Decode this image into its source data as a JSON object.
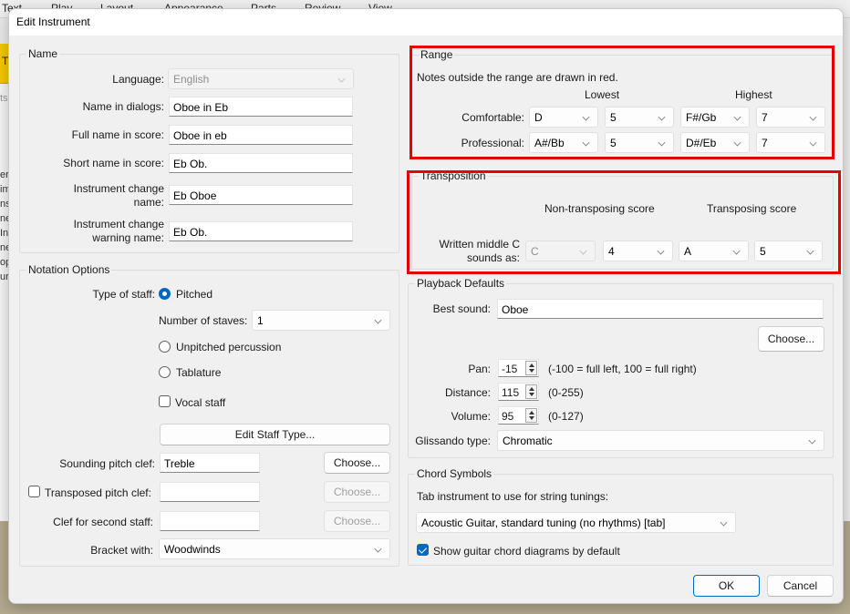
{
  "background_app": {
    "menu": [
      "Text",
      "Play",
      "Layout",
      "Appearance",
      "Parts",
      "Review",
      "View"
    ],
    "toolbar_fragment": "Tr",
    "panel_fragments": [
      "ts",
      "er",
      "im",
      "ns",
      "ne",
      "In",
      "ne",
      "op",
      "ur"
    ]
  },
  "dialog": {
    "title": "Edit Instrument",
    "name_group": {
      "legend": "Name",
      "language_label": "Language:",
      "language_value": "English",
      "name_in_dialogs_label": "Name in dialogs:",
      "name_in_dialogs_value": "Oboe in Eb",
      "full_name_label": "Full name in score:",
      "full_name_value": "Oboe in eb",
      "short_name_label": "Short name in score:",
      "short_name_value": "Eb Ob.",
      "change_name_label": "Instrument change name:",
      "change_name_value": "Eb Oboe",
      "change_warning_label": "Instrument change warning name:",
      "change_warning_value": "Eb Ob."
    },
    "notation_group": {
      "legend": "Notation Options",
      "type_of_staff_label": "Type of staff:",
      "pitched_label": "Pitched",
      "pitched_selected": true,
      "num_staves_label": "Number of staves:",
      "num_staves_value": "1",
      "unpitched_label": "Unpitched percussion",
      "tablature_label": "Tablature",
      "vocal_staff_label": "Vocal staff",
      "vocal_staff_checked": false,
      "edit_staff_type_button": "Edit Staff Type...",
      "sounding_clef_label": "Sounding pitch clef:",
      "sounding_clef_value": "Treble",
      "choose_label": "Choose...",
      "transposed_clef_label": "Transposed pitch clef:",
      "transposed_clef_checked": false,
      "transposed_clef_value": "",
      "second_staff_clef_label": "Clef for second staff:",
      "second_staff_clef_value": "",
      "bracket_label": "Bracket with:",
      "bracket_value": "Woodwinds"
    },
    "range_group": {
      "legend": "Range",
      "note": "Notes outside the range are drawn in red.",
      "lowest_header": "Lowest",
      "highest_header": "Highest",
      "comfortable_label": "Comfortable:",
      "comfortable": {
        "low_note": "D",
        "low_octave": "5",
        "high_note": "F#/Gb",
        "high_octave": "7"
      },
      "professional_label": "Professional:",
      "professional": {
        "low_note": "A#/Bb",
        "low_octave": "5",
        "high_note": "D#/Eb",
        "high_octave": "7"
      }
    },
    "transposition_group": {
      "legend": "Transposition",
      "non_transposing_header": "Non-transposing score",
      "transposing_header": "Transposing score",
      "written_c_label": "Written middle C sounds as:",
      "non_transposing": {
        "note": "C",
        "octave": "4"
      },
      "transposing": {
        "note": "A",
        "octave": "5"
      }
    },
    "playback_group": {
      "legend": "Playback Defaults",
      "best_sound_label": "Best sound:",
      "best_sound_value": "Oboe",
      "choose_label": "Choose...",
      "pan_label": "Pan:",
      "pan_value": "-15",
      "pan_hint": "(-100 = full left, 100 = full right)",
      "distance_label": "Distance:",
      "distance_value": "115",
      "distance_hint": "(0-255)",
      "volume_label": "Volume:",
      "volume_value": "95",
      "volume_hint": "(0-127)",
      "glissando_label": "Glissando type:",
      "glissando_value": "Chromatic"
    },
    "chord_group": {
      "legend": "Chord Symbols",
      "tab_instrument_label": "Tab instrument to use for string tunings:",
      "tab_instrument_value": "Acoustic Guitar, standard tuning (no rhythms) [tab]",
      "show_diagrams_label": "Show guitar chord diagrams by default",
      "show_diagrams_checked": true
    },
    "ok_label": "OK",
    "cancel_label": "Cancel"
  },
  "colors": {
    "accent": "#0067c0",
    "highlight_box": "#e60000"
  }
}
